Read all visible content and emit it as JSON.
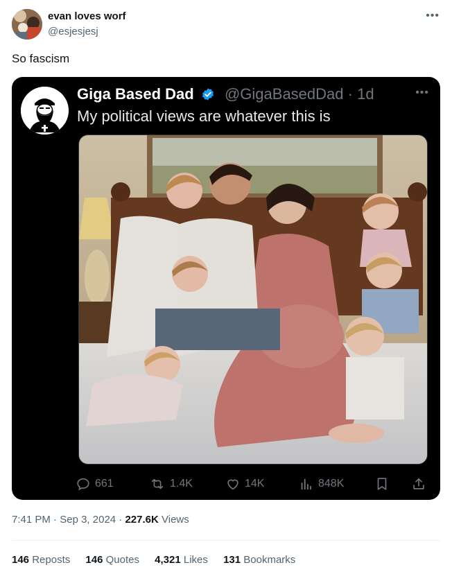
{
  "author": {
    "name": "evan loves worf",
    "handle": "@esjesjesj"
  },
  "tweet_text": "So fascism",
  "more_icon": "more-horizontal-icon",
  "embedded": {
    "name": "Giga Based Dad",
    "handle": "@GigaBasedDad",
    "separator": "·",
    "age": "1d",
    "text": "My political views are whatever this is",
    "actions": {
      "replies": "661",
      "reposts": "1.4K",
      "likes": "14K",
      "views": "848K"
    },
    "colors": {
      "background": "#000000",
      "verified": "#1d9bf0",
      "muted": "#71767b"
    }
  },
  "footer": {
    "time": "7:41 PM",
    "dot1": "·",
    "date": "Sep 3, 2024",
    "dot2": "·",
    "views_count": "227.6K",
    "views_label": "Views"
  },
  "stats": {
    "reposts_count": "146",
    "reposts_label": "Reposts",
    "quotes_count": "146",
    "quotes_label": "Quotes",
    "likes_count": "4,321",
    "likes_label": "Likes",
    "bookmarks_count": "131",
    "bookmarks_label": "Bookmarks"
  }
}
